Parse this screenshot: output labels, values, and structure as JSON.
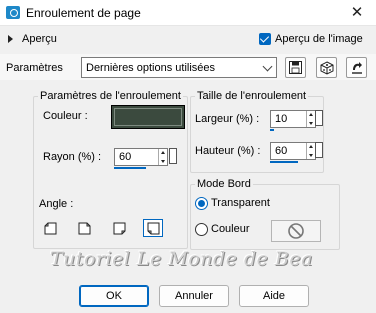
{
  "window": {
    "title": "Enroulement de page",
    "close_glyph": "✕"
  },
  "preview": {
    "label": "Aperçu",
    "image_preview_label": "Aperçu de l'image",
    "image_preview_checked": true
  },
  "params": {
    "label": "Paramètres",
    "preset_value": "Dernières options utilisées"
  },
  "curl_params": {
    "group_title": "Paramètres de l'enroulement",
    "color_label": "Couleur :",
    "color_value": "#3b4a3e",
    "radius_label": "Rayon (%) :",
    "radius_value": "60",
    "angle_label": "Angle :"
  },
  "curl_size": {
    "group_title": "Taille de l'enroulement",
    "width_label": "Largeur (%) :",
    "width_value": "10",
    "height_label": "Hauteur (%) :",
    "height_value": "60"
  },
  "edge_mode": {
    "group_title": "Mode Bord",
    "transparent_label": "Transparent",
    "color_label": "Couleur",
    "selected": "transparent"
  },
  "watermark": "Tutoriel Le Monde de Bea",
  "buttons": {
    "ok": "OK",
    "cancel": "Annuler",
    "help": "Aide"
  },
  "colors": {
    "accent": "#0067c0",
    "swatch": "#3b4a3e"
  }
}
